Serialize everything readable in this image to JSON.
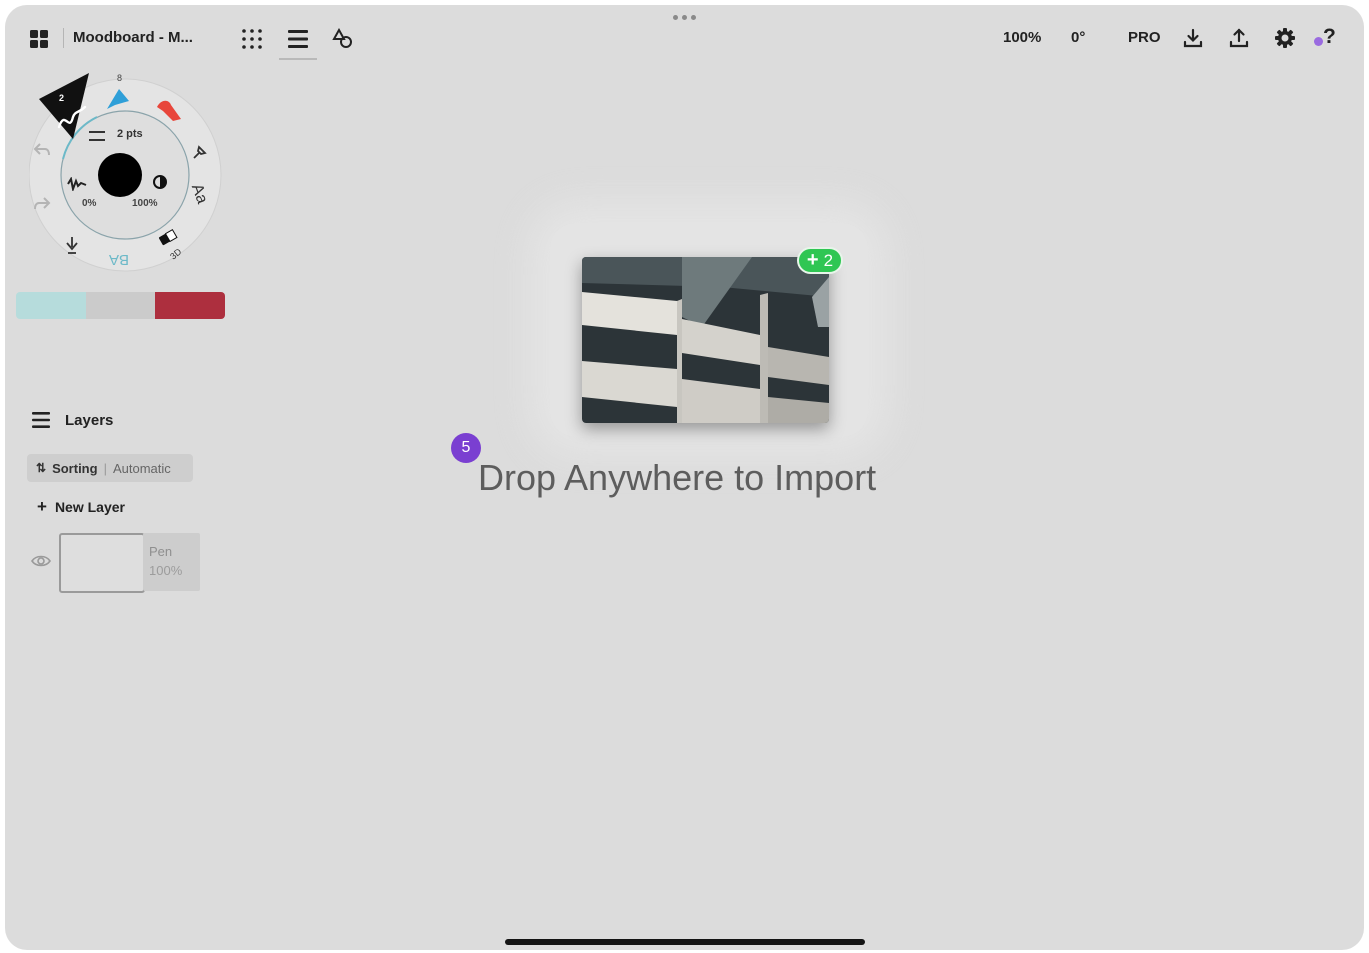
{
  "app": {
    "document_title": "Moodboard - M...",
    "zoom": "100%",
    "rotation": "0°",
    "pro_label": "PRO"
  },
  "toolbar": {
    "icons": [
      "gallery-icon",
      "grid-icon",
      "layers-menu-icon",
      "shapes-icon",
      "download-icon",
      "upload-icon",
      "settings-icon",
      "help-icon"
    ],
    "help_label": "?"
  },
  "tool_wheel": {
    "brush_size": "2 pts",
    "opacity_min": "0%",
    "opacity_max": "100%",
    "top_label": "8",
    "brush_number": "2",
    "selection_label": "BA",
    "bottom_right_label": "3D"
  },
  "colors": {
    "swatches": [
      "#b6dcdc",
      "#cbcbcb",
      "#ad2f3e"
    ],
    "accent": "#7a3fd1",
    "badge_green": "#2fc653"
  },
  "layers": {
    "title": "Layers",
    "sorting_label": "Sorting",
    "sorting_divider": "|",
    "sorting_mode": "Automatic",
    "new_layer": "New Layer",
    "items": [
      {
        "name": "Pen",
        "opacity": "100%"
      }
    ]
  },
  "drop": {
    "message": "Drop Anywhere to Import",
    "extra_count": "2",
    "item_count": "5"
  }
}
